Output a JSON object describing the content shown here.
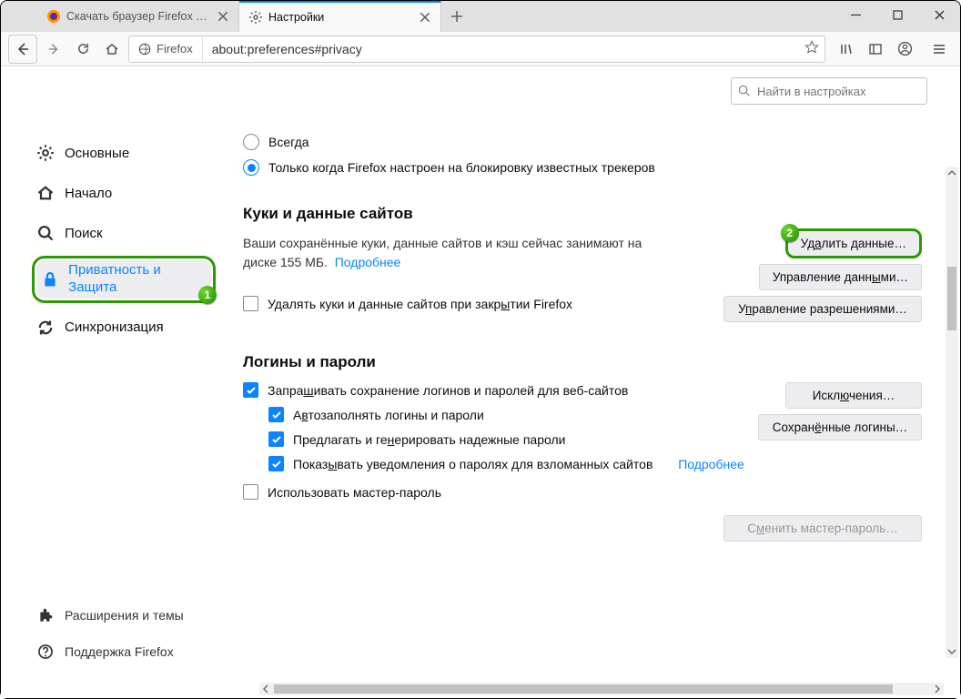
{
  "window": {
    "tabs": [
      {
        "title": "Скачать браузер Firefox для ко",
        "active": false,
        "favicon": "firefox"
      },
      {
        "title": "Настройки",
        "active": true,
        "favicon": "gear"
      }
    ]
  },
  "nav": {
    "identity_label": "Firefox",
    "url": "about:preferences#privacy"
  },
  "search": {
    "placeholder": "Найти в настройках"
  },
  "sidebar": {
    "items": [
      {
        "key": "general",
        "label": "Основные"
      },
      {
        "key": "home",
        "label": "Начало"
      },
      {
        "key": "search",
        "label": "Поиск"
      },
      {
        "key": "privacy",
        "label": "Приватность и Защита",
        "active": true
      },
      {
        "key": "sync",
        "label": "Синхронизация"
      }
    ],
    "bottom": [
      {
        "key": "extensions",
        "label": "Расширения и темы"
      },
      {
        "key": "support",
        "label": "Поддержка Firefox"
      }
    ]
  },
  "callouts": {
    "n1": "1",
    "n2": "2"
  },
  "contentBlocking": {
    "option_always": "Всегда",
    "option_trackers": "Только когда Firefox настроен на блокировку известных трекеров"
  },
  "cookies": {
    "heading": "Куки и данные сайтов",
    "desc1": "Ваши сохранённые куки, данные сайтов и кэш сейчас занимают на диске ",
    "size": "155 МБ",
    "dot": ".",
    "learn": "Подробнее",
    "clear_on_close_pre": "Удалять куки и данные сайтов при закр",
    "clear_on_close_u": "ы",
    "clear_on_close_post": "тии Firefox",
    "btn_clear_pre": "Уд",
    "btn_clear_u": "а",
    "btn_clear_post": "лить данные…",
    "btn_manage_pre": "Управление данн",
    "btn_manage_u": "ы",
    "btn_manage_post": "ми…",
    "btn_perm_pre": "У",
    "btn_perm_u": "п",
    "btn_perm_post": "равление разрешениями…"
  },
  "logins": {
    "heading": "Логины и пароли",
    "ask_save_pre": "Запра",
    "ask_save_u": "ш",
    "ask_save_post": "ивать сохранение логинов и паролей для веб-сайтов",
    "autofill_pre": "А",
    "autofill_u": "в",
    "autofill_post": "тозаполнять логины и пароли",
    "suggest_pre": "Предлагать и ге",
    "suggest_u": "н",
    "suggest_post": "ерировать надежные пароли",
    "breach_pre": "Показ",
    "breach_u": "ы",
    "breach_post": "вать уведомления о паролях для взломанных сайтов",
    "breach_learn": "Подробнее",
    "master_label": "Использовать мастер-пароль",
    "btn_exceptions_pre": "Искл",
    "btn_exceptions_u": "ю",
    "btn_exceptions_post": "чения…",
    "btn_saved_pre": "Сохран",
    "btn_saved_u": "ё",
    "btn_saved_post": "нные логины…",
    "btn_change_master_pre": "С",
    "btn_change_master_u": "м",
    "btn_change_master_post": "енить мастер-пароль…"
  }
}
